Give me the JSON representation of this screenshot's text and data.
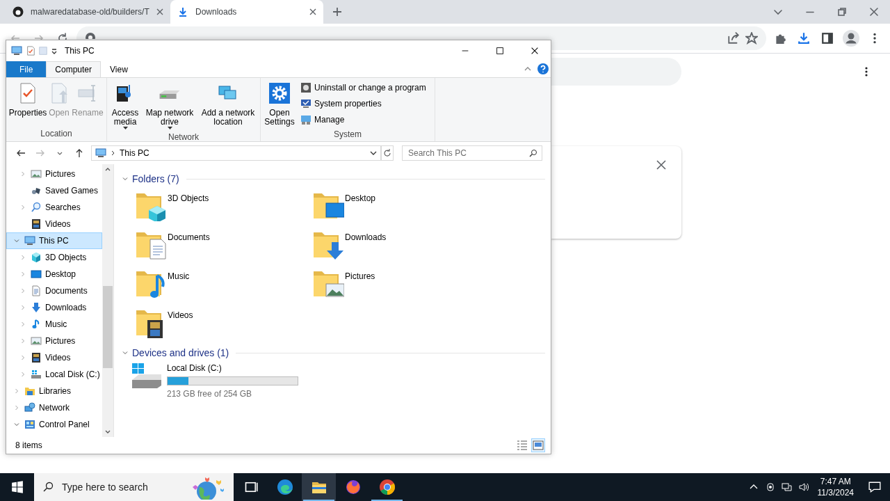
{
  "browser": {
    "tabs": [
      {
        "title": "malwaredatabase-old/builders/T",
        "kind": "github",
        "selected": false
      },
      {
        "title": "Downloads",
        "kind": "download",
        "selected": true
      }
    ]
  },
  "explorer": {
    "title": "This PC",
    "ribbon": {
      "tabs": [
        {
          "label": "File",
          "kind": "file",
          "selected": false
        },
        {
          "label": "Computer",
          "kind": "tab",
          "selected": true
        },
        {
          "label": "View",
          "kind": "tab",
          "selected": false
        }
      ],
      "groups": [
        {
          "label": "Location",
          "buttons": [
            {
              "label": "Properties",
              "kind": "properties",
              "disabled": false,
              "dropdown": false
            },
            {
              "label": "Open",
              "kind": "open",
              "disabled": true,
              "dropdown": false
            },
            {
              "label": "Rename",
              "kind": "rename",
              "disabled": true,
              "dropdown": false
            }
          ]
        },
        {
          "label": "Network",
          "buttons": [
            {
              "label": "Access media",
              "kind": "media",
              "disabled": false,
              "dropdown": true
            },
            {
              "label": "Map network drive",
              "kind": "netdrive",
              "disabled": false,
              "dropdown": true
            },
            {
              "label": "Add a network location",
              "kind": "netloc",
              "disabled": false,
              "dropdown": false
            }
          ]
        },
        {
          "label": "System",
          "buttons": [
            {
              "label": "Open Settings",
              "kind": "settings",
              "disabled": false,
              "dropdown": false
            }
          ],
          "small_buttons": [
            {
              "label": "Uninstall or change a program",
              "kind": "uninstall"
            },
            {
              "label": "System properties",
              "kind": "sysprops"
            },
            {
              "label": "Manage",
              "kind": "manage"
            }
          ]
        }
      ]
    },
    "address": {
      "location": "This PC",
      "search_placeholder": "Search This PC"
    },
    "nav_pane": {
      "continued_items": [
        {
          "label": "Pictures",
          "kind": "pictures",
          "expandable": true,
          "expanded": false,
          "selected": false
        },
        {
          "label": "Saved Games",
          "kind": "games",
          "expandable": false,
          "selected": false
        },
        {
          "label": "Searches",
          "kind": "searches",
          "expandable": true,
          "expanded": false,
          "selected": false
        },
        {
          "label": "Videos",
          "kind": "videos",
          "expandable": false,
          "selected": false
        }
      ],
      "items": [
        {
          "label": "This PC",
          "kind": "pc",
          "expandable": true,
          "expanded": true,
          "selected": true,
          "children": [
            {
              "label": "3D Objects",
              "kind": "cube",
              "expandable": true,
              "expanded": false,
              "selected": false
            },
            {
              "label": "Desktop",
              "kind": "desktop",
              "expandable": true,
              "expanded": false,
              "selected": false
            },
            {
              "label": "Documents",
              "kind": "documents",
              "expandable": true,
              "expanded": false,
              "selected": false
            },
            {
              "label": "Downloads",
              "kind": "downloads",
              "expandable": true,
              "expanded": false,
              "selected": false
            },
            {
              "label": "Music",
              "kind": "music",
              "expandable": true,
              "expanded": false,
              "selected": false
            },
            {
              "label": "Pictures",
              "kind": "pictures",
              "expandable": true,
              "expanded": false,
              "selected": false
            },
            {
              "label": "Videos",
              "kind": "videos",
              "expandable": true,
              "expanded": false,
              "selected": false
            },
            {
              "label": "Local Disk (C:)",
              "kind": "disk",
              "expandable": true,
              "expanded": false,
              "selected": false
            }
          ]
        },
        {
          "label": "Libraries",
          "kind": "libraries",
          "expandable": true,
          "expanded": false,
          "selected": false
        },
        {
          "label": "Network",
          "kind": "network",
          "expandable": true,
          "expanded": false,
          "selected": false
        },
        {
          "label": "Control Panel",
          "kind": "control",
          "expandable": true,
          "expanded": true,
          "selected": false
        }
      ]
    },
    "sections": [
      {
        "title": "Folders (7)",
        "kind": "folders",
        "items": [
          {
            "label": "3D Objects",
            "kind": "cube"
          },
          {
            "label": "Desktop",
            "kind": "desktop"
          },
          {
            "label": "Documents",
            "kind": "documents"
          },
          {
            "label": "Downloads",
            "kind": "downloads"
          },
          {
            "label": "Music",
            "kind": "music"
          },
          {
            "label": "Pictures",
            "kind": "pictures"
          },
          {
            "label": "Videos",
            "kind": "videos"
          }
        ]
      },
      {
        "title": "Devices and drives (1)",
        "kind": "drives",
        "items": [
          {
            "label": "Local Disk (C:)",
            "level": 0.16,
            "free": "213 GB free of 254 GB"
          }
        ]
      }
    ],
    "status": "8 items",
    "view_buttons": [
      {
        "kind": "details",
        "selected": false
      },
      {
        "kind": "tiles",
        "selected": true
      }
    ]
  },
  "taskbar": {
    "search_placeholder": "Type here to search",
    "apps": [
      {
        "kind": "taskview",
        "open": false,
        "active": false
      },
      {
        "kind": "edge",
        "open": false,
        "active": false
      },
      {
        "kind": "explorer",
        "open": true,
        "active": true
      },
      {
        "kind": "firefox",
        "open": false,
        "active": false
      },
      {
        "kind": "chrome",
        "open": true,
        "active": false
      }
    ],
    "time": "7:47 AM",
    "date": "11/3/2024"
  }
}
